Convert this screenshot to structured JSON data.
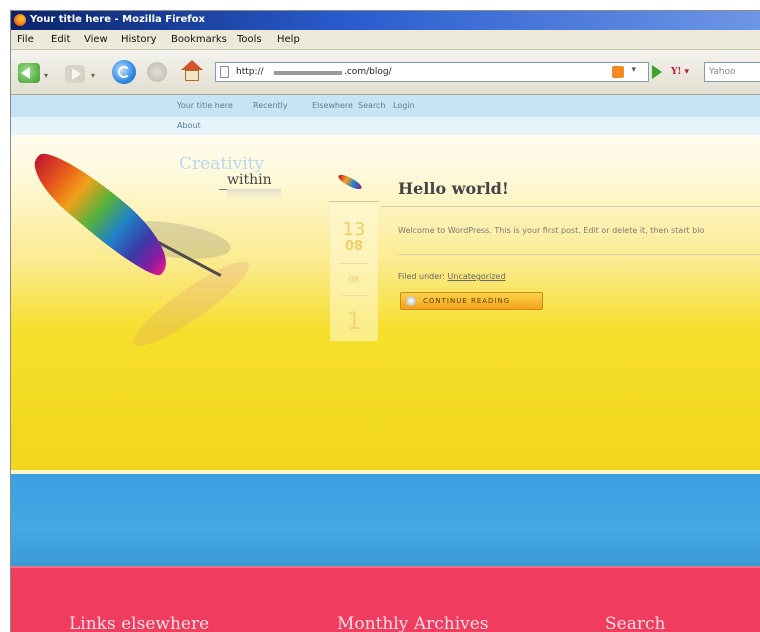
{
  "window": {
    "title": "Your title here - Mozilla Firefox"
  },
  "menubar": [
    "File",
    "Edit",
    "View",
    "History",
    "Bookmarks",
    "Tools",
    "Help"
  ],
  "toolbar": {
    "url_prefix": "http://",
    "url_suffix": ".com/blog/",
    "search_placeholder": "Yahoo",
    "search_engine_label": "Y!"
  },
  "site_nav": {
    "links": [
      "Your title here",
      "Recently",
      "Elsewhere",
      "Search",
      "Login"
    ],
    "links_row2": [
      "About"
    ]
  },
  "logo": {
    "line1": "Creativity",
    "line2": "within"
  },
  "post": {
    "date_day": "13",
    "date_month": "08",
    "date_year": "08",
    "comment_count": "1",
    "title": "Hello world!",
    "excerpt": "Welcome to WordPress. This is your first post. Edit or delete it, then start blo",
    "filed_label": "Filed under:",
    "filed_category": "Uncategorized",
    "continue_label": "CONTINUE READING"
  },
  "footer": {
    "headings": [
      "Links elsewhere",
      "Monthly Archives",
      "Search"
    ]
  },
  "colors": {
    "accent_yellow": "#f1d61c",
    "band_blue": "#3aa0e0",
    "band_pink": "#f03c5e",
    "nav_blue": "#c7e4f6"
  },
  "icons": [
    "firefox-logo-icon",
    "back-arrow-icon",
    "forward-arrow-icon",
    "reload-icon",
    "stop-icon",
    "home-icon",
    "page-icon",
    "rss-feed-icon",
    "go-arrow-icon",
    "yahoo-search-icon",
    "feather-logo-icon",
    "continue-bullet-icon"
  ]
}
